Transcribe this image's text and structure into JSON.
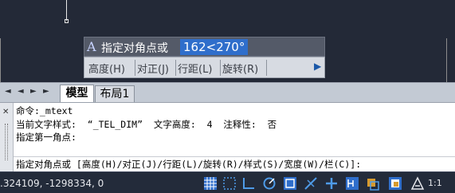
{
  "dynamic_input": {
    "prompt": "指定对角点或",
    "value": "162<270°"
  },
  "options": {
    "height": "高度(H)",
    "justify": "对正(J)",
    "line_spacing": "行距(L)",
    "rotation": "旋转(R)"
  },
  "tabs": {
    "nav_first": "◄",
    "nav_prev": "◄",
    "nav_next": "►",
    "nav_last": "►",
    "model": "模型",
    "layout1": "布局1"
  },
  "command": {
    "close": "✕",
    "lines": [
      "命令:_mtext",
      "当前文字样式:  “_TEL_DIM”  文字高度:  4  注释性:  否",
      "指定第一角点:"
    ],
    "prompt": "指定对角点或 [高度(H)/对正(J)/行距(L)/旋转(R)/样式(S)/宽度(W)/栏(C)]:"
  },
  "status_bar": {
    "coordinates": ".324109, -1298334, 0",
    "scale": "1:1",
    "icons": [
      "grid-icon",
      "snap-icon",
      "ortho-icon",
      "polar-icon",
      "osnap-icon",
      "otrack-icon",
      "ducs-icon",
      "dyn-icon",
      "lineweight-icon",
      "transparency-icon",
      "annotation-icon"
    ]
  },
  "colors": {
    "canvas": "#232937",
    "highlight": "#2f6ecb",
    "status": "#232b3a"
  }
}
